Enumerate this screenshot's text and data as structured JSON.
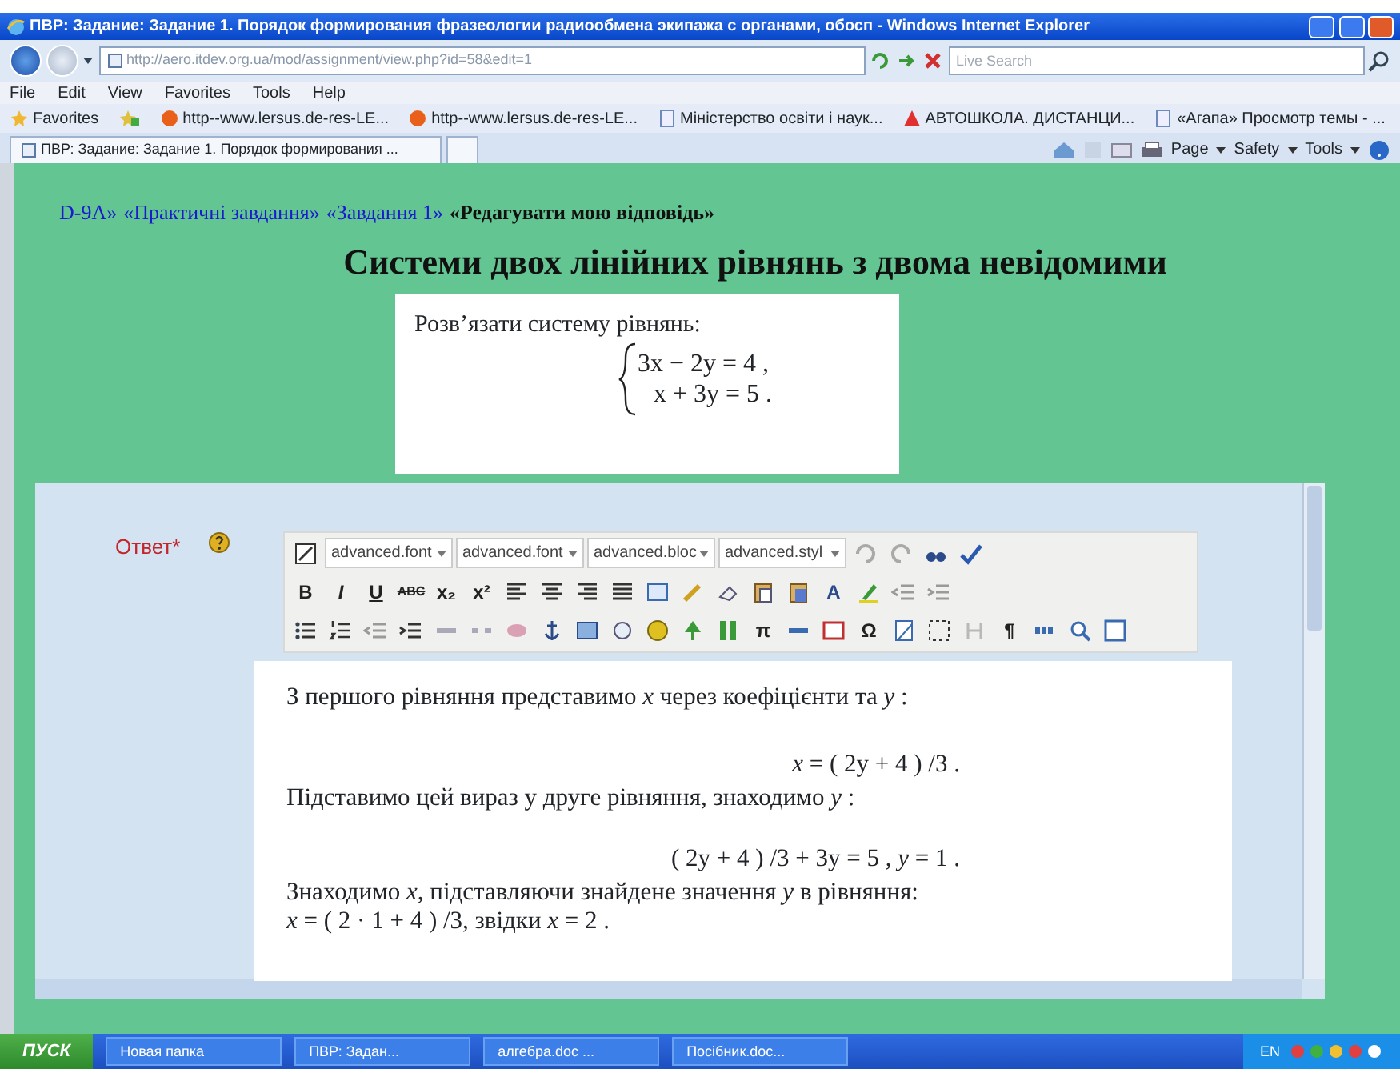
{
  "window": {
    "title": "ПВР: Задание: Задание 1. Порядок формирования фразеологии радиообмена экипажа с органами, обосп - Windows Internet Explorer"
  },
  "address_bar": {
    "url": "http://aero.itdev.org.ua/mod/assignment/view.php?id=58&edit=1",
    "search_placeholder": "Live Search"
  },
  "menu": [
    "File",
    "Edit",
    "View",
    "Favorites",
    "Tools",
    "Help"
  ],
  "favorites": {
    "label": "Favorites",
    "links": [
      {
        "text": "http--www.lersus.de-res-LE...",
        "kind": "globe"
      },
      {
        "text": "http--www.lersus.de-res-LE...",
        "kind": "globe"
      },
      {
        "text": "Міністерство освіти і наук...",
        "kind": "page"
      },
      {
        "text": "АВТОШКОЛА. ДИСТАНЦИ...",
        "kind": "warning"
      },
      {
        "text": "«Агапа» Просмотр темы - ...",
        "kind": "page"
      }
    ]
  },
  "tabs": [
    {
      "label": "ПВР: Задание: Задание 1. Порядок формирования ...",
      "selected": true
    }
  ],
  "command_bar": [
    "Page",
    "Safety",
    "Tools"
  ],
  "breadcrumb": [
    {
      "text": "D-9A»",
      "kind": "link"
    },
    {
      "text": "«Практичні завдання»",
      "kind": "link"
    },
    {
      "text": "«Завдання 1»",
      "kind": "link"
    },
    {
      "text": "«Редагувати мою відповідь»",
      "kind": "current"
    }
  ],
  "heading": "Системи двох лінійних рівнянь з двома невідомими",
  "task": {
    "prompt": "Розв’язати систему рівнянь:",
    "equations": [
      "3x − 2y = 4 ,",
      "x + 3y = 5 ."
    ]
  },
  "answer": {
    "label": "Ответ*",
    "toolbar": [
      [
        {
          "kind": "icon",
          "disabled": false
        },
        {
          "kind": "select",
          "text": "advanced.font"
        },
        {
          "kind": "select",
          "text": "advanced.font"
        },
        {
          "kind": "select",
          "text": "advanced.bloc"
        },
        {
          "kind": "select",
          "text": "advanced.styl"
        },
        {
          "kind": "icon",
          "disabled": true
        },
        {
          "kind": "icon",
          "disabled": true
        },
        {
          "kind": "icon",
          "disabled": false
        },
        {
          "kind": "icon",
          "disabled": false
        }
      ],
      [
        {
          "kind": "glyph",
          "text": "B",
          "disabled": false
        },
        {
          "kind": "glyph",
          "text": "I",
          "disabled": false
        },
        {
          "kind": "glyph",
          "text": "U",
          "disabled": false
        },
        {
          "kind": "glyph",
          "text": "ABC",
          "disabled": false
        },
        {
          "kind": "glyph",
          "text": "x₂",
          "disabled": false
        },
        {
          "kind": "glyph",
          "text": "x²",
          "disabled": false
        },
        {
          "kind": "icon",
          "disabled": false
        },
        {
          "kind": "icon",
          "disabled": false
        },
        {
          "kind": "icon",
          "disabled": false
        },
        {
          "kind": "icon",
          "disabled": false
        },
        {
          "kind": "icon",
          "disabled": false
        },
        {
          "kind": "icon",
          "disabled": false
        },
        {
          "kind": "icon",
          "disabled": false
        },
        {
          "kind": "icon",
          "disabled": false
        },
        {
          "kind": "icon",
          "disabled": false
        },
        {
          "kind": "glyph",
          "text": "A",
          "disabled": false
        },
        {
          "kind": "icon",
          "disabled": false
        },
        {
          "kind": "icon",
          "disabled": true
        },
        {
          "kind": "icon",
          "disabled": true
        }
      ],
      [
        {
          "kind": "icon",
          "disabled": false
        },
        {
          "kind": "icon",
          "disabled": false
        },
        {
          "kind": "icon",
          "disabled": true
        },
        {
          "kind": "icon",
          "disabled": false
        },
        {
          "kind": "icon",
          "disabled": true
        },
        {
          "kind": "icon",
          "disabled": true
        },
        {
          "kind": "icon",
          "disabled": true
        },
        {
          "kind": "icon",
          "disabled": false
        },
        {
          "kind": "icon",
          "disabled": false
        },
        {
          "kind": "icon",
          "disabled": false
        },
        {
          "kind": "icon",
          "disabled": false
        },
        {
          "kind": "icon",
          "disabled": false
        },
        {
          "kind": "icon",
          "disabled": false
        },
        {
          "kind": "glyph",
          "text": "π",
          "disabled": false
        },
        {
          "kind": "icon",
          "disabled": false
        },
        {
          "kind": "icon",
          "disabled": false
        },
        {
          "kind": "glyph",
          "text": "Ω",
          "disabled": false
        },
        {
          "kind": "icon",
          "disabled": false
        },
        {
          "kind": "icon",
          "disabled": false
        },
        {
          "kind": "icon",
          "disabled": true
        },
        {
          "kind": "glyph",
          "text": "¶",
          "disabled": false
        },
        {
          "kind": "icon",
          "disabled": false
        },
        {
          "kind": "icon",
          "disabled": false
        },
        {
          "kind": "icon",
          "disabled": false
        }
      ]
    ],
    "content": [
      {
        "text": "З першого рівняння представимо  *x*  через коефіцієнти та *y* :",
        "kind": "text"
      },
      {
        "text": "*x* = ( 2y + 4 ) /3 .",
        "kind": "formula"
      },
      {
        "text": "Підставимо цей вираз у друге рівняння, знаходимо *y* :",
        "kind": "text"
      },
      {
        "text": "( 2y + 4 ) /3 + 3y = 5 ,   *y* = 1 .",
        "kind": "formula"
      },
      {
        "text": "Знаходимо  *x*, підставляючи знайдене значення *y*  в рівняння:",
        "kind": "text"
      },
      {
        "text": "*x* = ( 2 · 1 + 4 ) /3,  звідки  *x* = 2 .",
        "kind": "text"
      }
    ]
  },
  "taskbar": {
    "start": "ПУСК",
    "items": [
      "Новая папка",
      "ПВР: Задан...",
      "алгебра.doc ...",
      "Посібник.doc..."
    ],
    "language": "EN"
  }
}
